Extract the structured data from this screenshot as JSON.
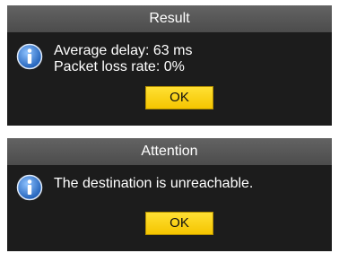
{
  "result_dialog": {
    "title": "Result",
    "lines": [
      "Average delay: 63 ms",
      "Packet loss rate: 0%"
    ],
    "ok_label": "OK"
  },
  "attention_dialog": {
    "title": "Attention",
    "message": "The destination is unreachable.",
    "ok_label": "OK"
  },
  "icons": {
    "info": "info-icon"
  },
  "colors": {
    "dialog_background": "#1c1c1c",
    "titlebar": "#555555",
    "button": "#f7cb00",
    "icon": "#2e7ad6"
  }
}
